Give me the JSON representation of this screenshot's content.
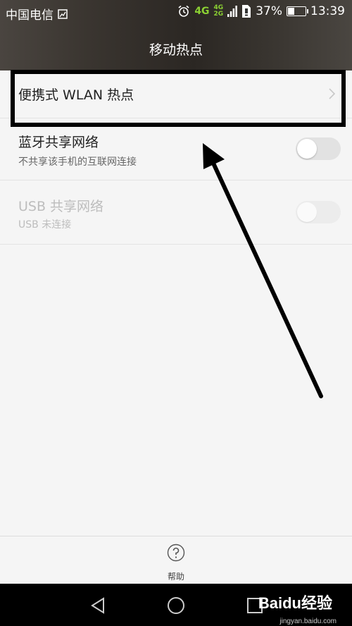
{
  "statusbar": {
    "carrier": "中国电信",
    "network_4g": "4G",
    "network_stack_top": "4G",
    "network_stack_bottom": "2G",
    "battery_percent": "37%",
    "battery_level": 0.37,
    "time": "13:39"
  },
  "header": {
    "title": "移动热点"
  },
  "items": [
    {
      "title": "便携式 WLAN 热点"
    },
    {
      "title": "蓝牙共享网络",
      "subtitle": "不共享该手机的互联网连接",
      "toggle_on": false
    },
    {
      "title": "USB 共享网络",
      "subtitle": "USB 未连接",
      "toggle_on": false,
      "enabled": false
    }
  ],
  "bottom": {
    "help_label": "帮助"
  },
  "watermark": {
    "brand": "Baidu经验",
    "url": "jingyan.baidu.com"
  },
  "colors": {
    "accent_green": "#8bd033",
    "annotation": "#000000"
  }
}
